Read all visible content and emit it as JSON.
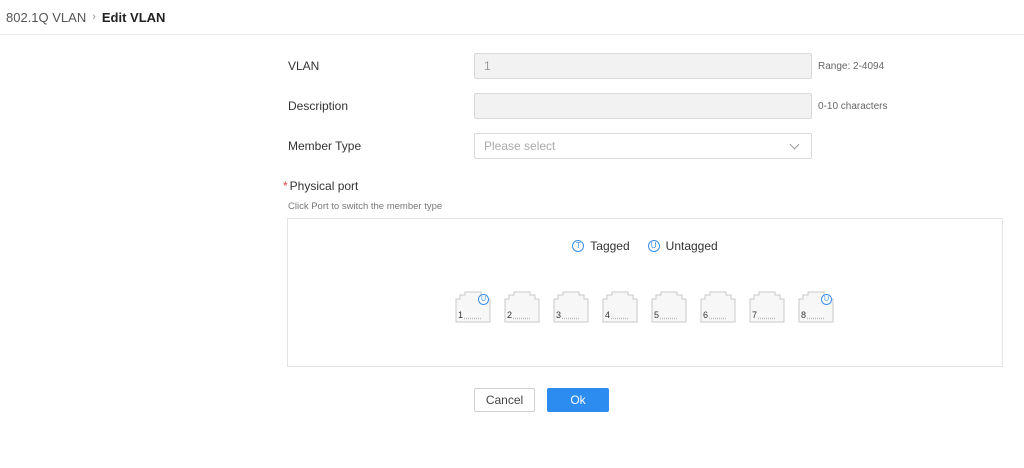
{
  "breadcrumb": {
    "parent": "802.1Q VLAN",
    "current": "Edit VLAN"
  },
  "form": {
    "vlan": {
      "label": "VLAN",
      "value": "1",
      "hint": "Range: 2-4094"
    },
    "description": {
      "label": "Description",
      "value": "",
      "hint": "0-10 characters"
    },
    "member_type": {
      "label": "Member Type",
      "placeholder": "Please select"
    },
    "physical_port": {
      "required_mark": "*",
      "label": "Physical port",
      "hint": "Click Port to switch the member type"
    }
  },
  "legend": {
    "tagged": {
      "symbol": "T",
      "label": "Tagged"
    },
    "untagged": {
      "symbol": "U",
      "label": "Untagged"
    }
  },
  "ports": [
    {
      "number": "1",
      "badge": "U"
    },
    {
      "number": "2",
      "badge": ""
    },
    {
      "number": "3",
      "badge": ""
    },
    {
      "number": "4",
      "badge": ""
    },
    {
      "number": "5",
      "badge": ""
    },
    {
      "number": "6",
      "badge": ""
    },
    {
      "number": "7",
      "badge": ""
    },
    {
      "number": "8",
      "badge": "U"
    }
  ],
  "buttons": {
    "cancel": "Cancel",
    "ok": "Ok"
  },
  "colors": {
    "primary": "#2d8cf0",
    "badge": "#3a8ee6",
    "required": "#e54545"
  }
}
